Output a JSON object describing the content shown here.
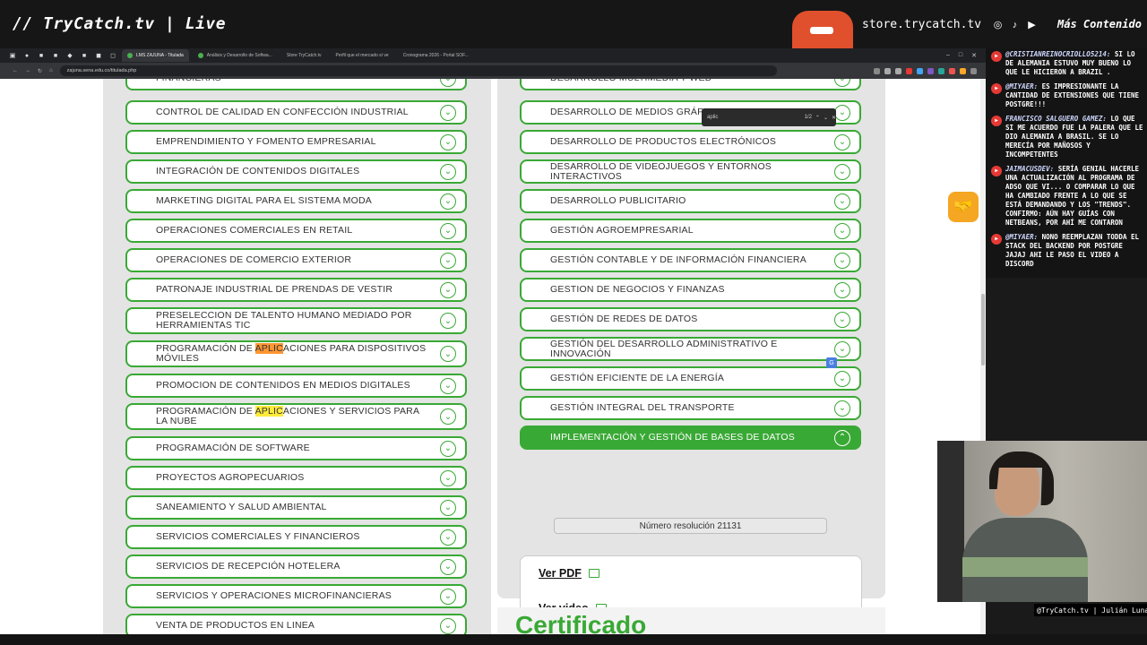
{
  "stream": {
    "title": "// TryCatch.tv | Live",
    "store": "store.trycatch.tv",
    "more": "Más Contenido",
    "cam_label": "@TryCatch.tv | Julián Luna"
  },
  "browser": {
    "tabs": [
      {
        "label": "LMS ZAJUNA - Titulada",
        "active": true
      },
      {
        "label": "Análisis y Desarrollo de Softwa...",
        "active": false
      },
      {
        "label": "Store TryCatch.tv",
        "active": false
      },
      {
        "label": "Perfil que el mercado sí ve",
        "active": false
      },
      {
        "label": "Cronograma 2026 - Portal SOF...",
        "active": false
      }
    ],
    "url": "zajuna.sena.edu.co/titulada.php",
    "find_query": "aplic",
    "find_count": "1/2"
  },
  "left_programs": [
    "FINANCIERAS",
    "CONTROL DE CALIDAD EN CONFECCIÓN INDUSTRIAL",
    "EMPRENDIMIENTO Y FOMENTO EMPRESARIAL",
    "INTEGRACIÓN DE CONTENIDOS DIGITALES",
    "MARKETING DIGITAL PARA EL SISTEMA MODA",
    "OPERACIONES COMERCIALES EN RETAIL",
    "OPERACIONES DE COMERCIO EXTERIOR",
    "PATRONAJE INDUSTRIAL DE PRENDAS DE VESTIR",
    "PRESELECCION DE TALENTO HUMANO MEDIADO POR HERRAMIENTAS TIC",
    "PROGRAMACIÓN DE APLICACIONES PARA DISPOSITIVOS MÓVILES",
    "PROMOCION DE CONTENIDOS EN MEDIOS DIGITALES",
    "PROGRAMACIÓN DE APLICACIONES Y SERVICIOS PARA LA NUBE",
    "PROGRAMACIÓN DE SOFTWARE",
    "PROYECTOS AGROPECUARIOS",
    "SANEAMIENTO Y SALUD AMBIENTAL",
    "SERVICIOS COMERCIALES Y FINANCIEROS",
    "SERVICIOS DE RECEPCIÓN HOTELERA",
    "SERVICIOS Y OPERACIONES MICROFINANCIERAS",
    "VENTA DE PRODUCTOS EN LINEA"
  ],
  "right_programs": [
    "DESARROLLO MULTIMEDIA Y WEB",
    "DESARROLLO DE MEDIOS GRÁFICOS VISUALES",
    "DESARROLLO DE PRODUCTOS ELECTRÓNICOS",
    "DESARROLLO DE VIDEOJUEGOS Y ENTORNOS INTERACTIVOS",
    "DESARROLLO PUBLICITARIO",
    "GESTIÓN AGROEMPRESARIAL",
    "GESTIÓN CONTABLE Y DE INFORMACIÓN FINANCIERA",
    "GESTION DE NEGOCIOS Y FINANZAS",
    "GESTIÓN DE REDES DE DATOS",
    "GESTIÓN DEL DESARROLLO ADMINISTRATIVO E INNOVACIÓN",
    "GESTIÓN EFICIENTE DE LA ENERGÍA",
    "GESTIÓN INTEGRAL DEL TRANSPORTE",
    "IMPLEMENTACIÓN Y GESTIÓN DE BASES DE DATOS"
  ],
  "selected_program": "IMPLEMENTACIÓN Y GESTIÓN DE BASES DE DATOS",
  "resolution": "Número resolución 21131",
  "links": {
    "pdf": "Ver PDF",
    "video": "Ver video"
  },
  "certificate_heading": "Certificado",
  "chat": [
    {
      "user": "@CRISTIANREINOCRIOLLO5214:",
      "text": "SI LO DE ALEMANIA ESTUVO MUY BUENO LO QUE LE HICIERON A BRAZIL ."
    },
    {
      "user": "@MIYAER:",
      "text": "ES IMPRESIONANTE LA CANTIDAD DE EXTENSIONES QUE TIENE POSTGRE!!!"
    },
    {
      "user": "FRANCISCO SALGUERO GAMEZ:",
      "text": "LO QUE SI ME ACUERDO FUE LA PALERA QUE LE DIO ALEMANIA A BRASIL. SE LO MERECÍA POR MAÑOSOS Y INCOMPETENTES"
    },
    {
      "user": "JAIMACUSDEV:",
      "text": "SERÍA GENIAL HACERLE UNA ACTUALIZACIÓN AL PROGRAMA DE ADSO QUE VI... O COMPARAR LO QUE HA CAMBIADO FRENTE A LO QUE SE ESTÁ DEMANDANDO Y LOS \"TRENDS\". CONFIRMO: AÚN HAY GUÍAS CON NETBEANS, POR AHÍ ME CONTARON"
    },
    {
      "user": "@MIYAER:",
      "text": "NONO REEMPLAZAN TODDA EL STACK DEL BACKEND POR POSTGRE JAJAJ AHI LE PASO EL VIDEO A DISCORD"
    }
  ],
  "colors": {
    "accent": "#39a935",
    "highlight": "#ffeb3b",
    "current_highlight": "#ff9632"
  }
}
